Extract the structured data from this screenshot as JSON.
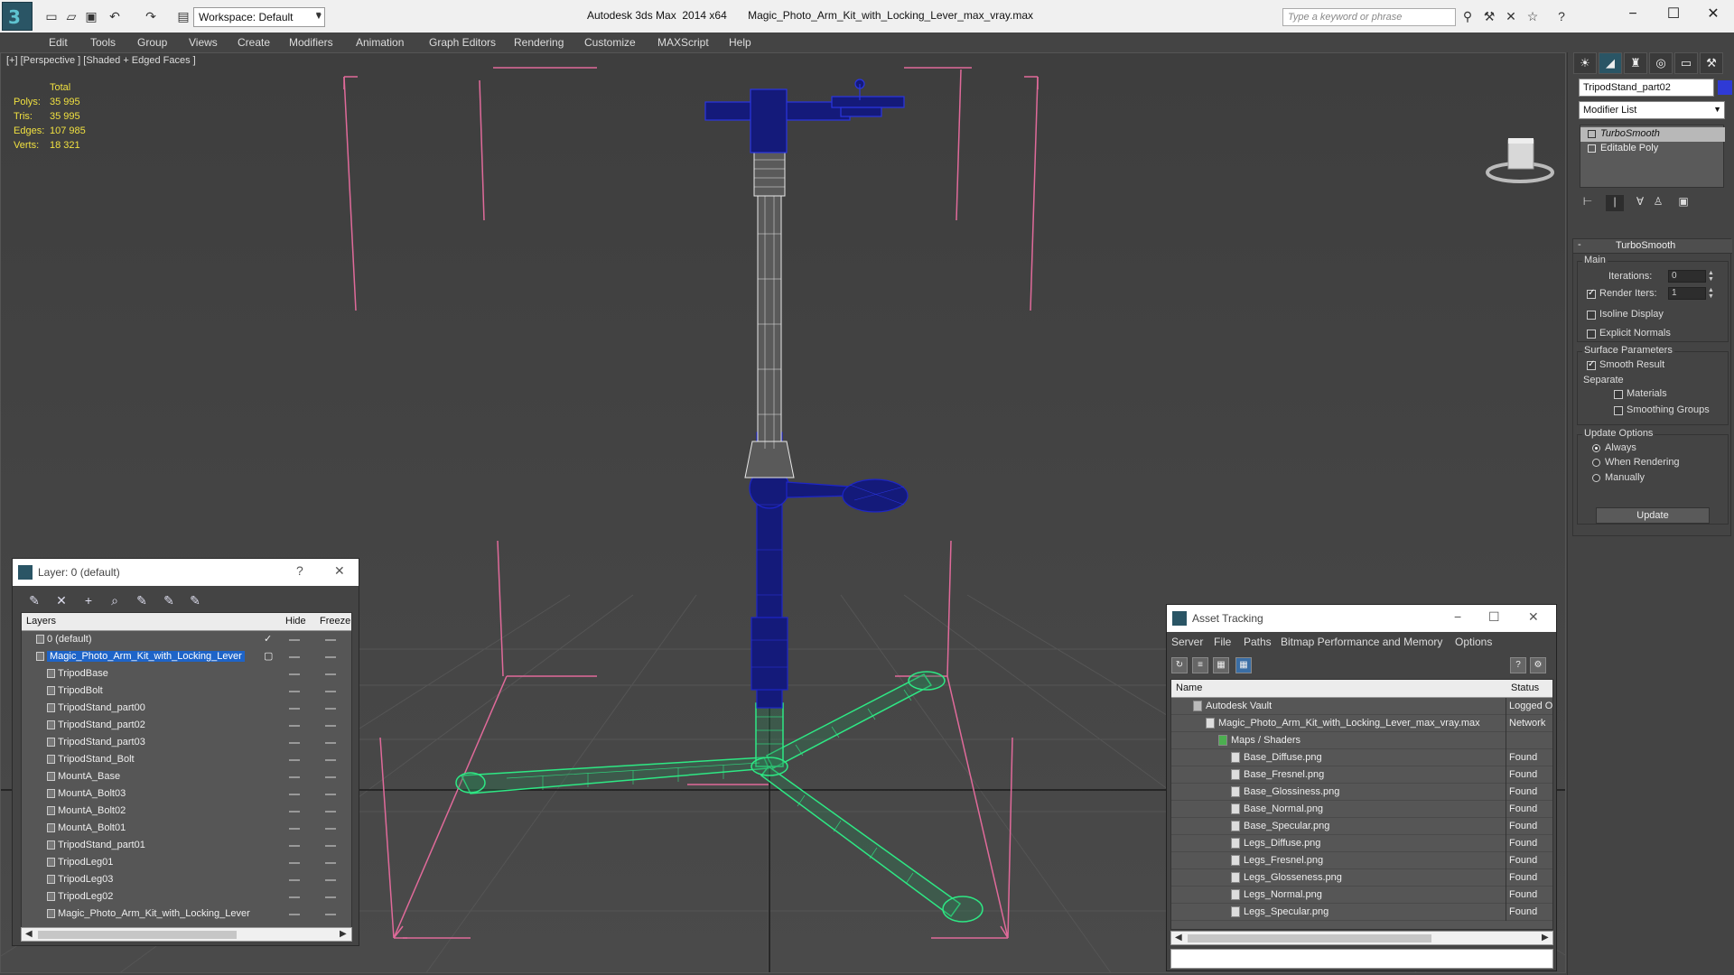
{
  "titlebar": {
    "workspace": "Workspace: Default",
    "app_title": "Autodesk 3ds Max  2014 x64       Magic_Photo_Arm_Kit_with_Locking_Lever_max_vray.max",
    "search_placeholder": "Type a keyword or phrase"
  },
  "menu": [
    "Edit",
    "Tools",
    "Group",
    "Views",
    "Create",
    "Modifiers",
    "Animation",
    "Graph Editors",
    "Rendering",
    "Customize",
    "MAXScript",
    "Help"
  ],
  "viewport": {
    "label": "[+] [Perspective ] [Shaded + Edged Faces ]",
    "stats": {
      "header": "Total",
      "rows": [
        {
          "label": "Polys:",
          "value": "35 995"
        },
        {
          "label": "Tris:",
          "value": "35 995"
        },
        {
          "label": "Edges:",
          "value": "107 985"
        },
        {
          "label": "Verts:",
          "value": "18 321"
        }
      ]
    }
  },
  "layer_dialog": {
    "title": "Layer: 0 (default)",
    "help": "?",
    "close": "✕",
    "columns": {
      "layers": "Layers",
      "hide": "Hide",
      "freeze": "Freeze"
    },
    "rows": [
      {
        "name": "0 (default)",
        "level": 0,
        "checked": true
      },
      {
        "name": "Magic_Photo_Arm_Kit_with_Locking_Lever",
        "level": 0,
        "selected": true
      },
      {
        "name": "TripodBase",
        "level": 1
      },
      {
        "name": "TripodBolt",
        "level": 1
      },
      {
        "name": "TripodStand_part00",
        "level": 1
      },
      {
        "name": "TripodStand_part02",
        "level": 1
      },
      {
        "name": "TripodStand_part03",
        "level": 1
      },
      {
        "name": "TripodStand_Bolt",
        "level": 1
      },
      {
        "name": "MountA_Base",
        "level": 1
      },
      {
        "name": "MountA_Bolt03",
        "level": 1
      },
      {
        "name": "MountA_Bolt02",
        "level": 1
      },
      {
        "name": "MountA_Bolt01",
        "level": 1
      },
      {
        "name": "TripodStand_part01",
        "level": 1
      },
      {
        "name": "TripodLeg01",
        "level": 1
      },
      {
        "name": "TripodLeg03",
        "level": 1
      },
      {
        "name": "TripodLeg02",
        "level": 1
      },
      {
        "name": "Magic_Photo_Arm_Kit_with_Locking_Lever",
        "level": 1
      }
    ]
  },
  "asset_dialog": {
    "title": "Asset Tracking",
    "menu": [
      "Server",
      "File",
      "Paths",
      "Bitmap Performance and Memory",
      "Options"
    ],
    "columns": {
      "name": "Name",
      "status": "Status"
    },
    "rows": [
      {
        "name": "Autodesk Vault",
        "status": "Logged O",
        "level": 1
      },
      {
        "name": "Magic_Photo_Arm_Kit_with_Locking_Lever_max_vray.max",
        "status": "Network",
        "level": 2
      },
      {
        "name": "Maps / Shaders",
        "status": "",
        "level": 3
      },
      {
        "name": "Base_Diffuse.png",
        "status": "Found",
        "level": 4
      },
      {
        "name": "Base_Fresnel.png",
        "status": "Found",
        "level": 4
      },
      {
        "name": "Base_Glossiness.png",
        "status": "Found",
        "level": 4
      },
      {
        "name": "Base_Normal.png",
        "status": "Found",
        "level": 4
      },
      {
        "name": "Base_Specular.png",
        "status": "Found",
        "level": 4
      },
      {
        "name": "Legs_Diffuse.png",
        "status": "Found",
        "level": 4
      },
      {
        "name": "Legs_Fresnel.png",
        "status": "Found",
        "level": 4
      },
      {
        "name": "Legs_Glosseness.png",
        "status": "Found",
        "level": 4
      },
      {
        "name": "Legs_Normal.png",
        "status": "Found",
        "level": 4
      },
      {
        "name": "Legs_Specular.png",
        "status": "Found",
        "level": 4
      }
    ]
  },
  "command_panel": {
    "object_name": "TripodStand_part02",
    "object_color": "#2f3ad6",
    "modifier_list": "Modifier List",
    "stack": [
      {
        "name": "TurboSmooth",
        "selected": true
      },
      {
        "name": "Editable Poly",
        "selected": false
      }
    ],
    "turbosmooth": {
      "title": "TurboSmooth",
      "collapse": "-",
      "main": "Main",
      "iterations_label": "Iterations:",
      "iterations": "0",
      "render_iters_label": "Render Iters:",
      "render_iters": "1",
      "render_iters_checked": true,
      "isoline_display": "Isoline Display",
      "explicit_normals": "Explicit Normals",
      "surface_params": "Surface Parameters",
      "smooth_result": "Smooth Result",
      "separate": "Separate",
      "materials": "Materials",
      "smoothing_groups": "Smoothing Groups",
      "update_options": "Update Options",
      "always": "Always",
      "when_rendering": "When Rendering",
      "manually": "Manually",
      "update_button": "Update"
    }
  },
  "colors": {
    "wire_blue": "#1a1f9a",
    "wire_green": "#2ee884",
    "wire_white": "#e8e8e8",
    "bbox_pink": "#e06a9a",
    "stats_yellow": "#f0e040"
  }
}
